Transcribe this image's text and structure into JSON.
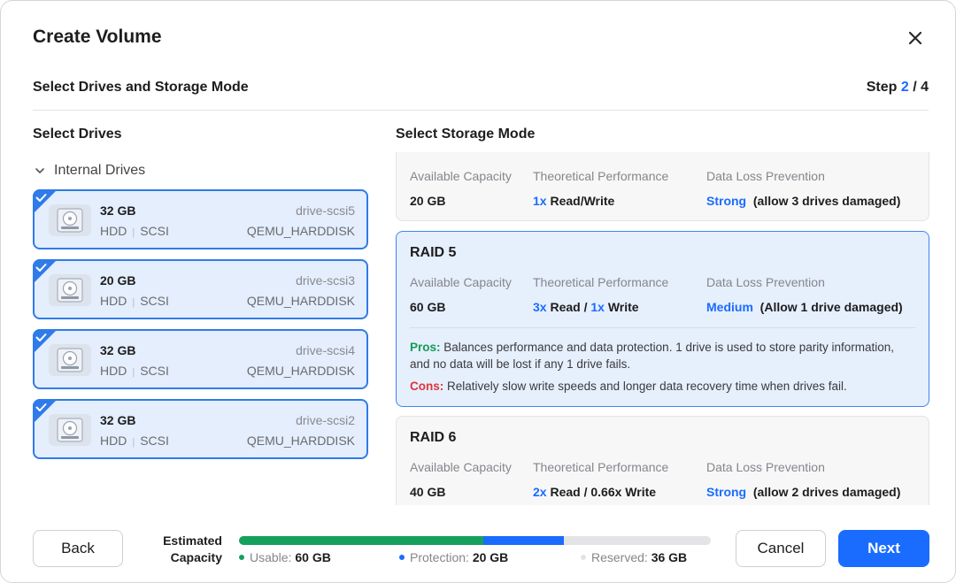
{
  "dialog": {
    "title": "Create Volume",
    "subtitle": "Select Drives and Storage Mode",
    "step_label": "Step",
    "step_current": "2",
    "step_sep": "/",
    "step_total": "4"
  },
  "drives_panel": {
    "title": "Select Drives",
    "group_label": "Internal Drives",
    "drives": [
      {
        "size": "32 GB",
        "type": "HDD",
        "bus": "SCSI",
        "id": "drive-scsi5",
        "model": "QEMU_HARDDISK",
        "selected": true
      },
      {
        "size": "20 GB",
        "type": "HDD",
        "bus": "SCSI",
        "id": "drive-scsi3",
        "model": "QEMU_HARDDISK",
        "selected": true
      },
      {
        "size": "32 GB",
        "type": "HDD",
        "bus": "SCSI",
        "id": "drive-scsi4",
        "model": "QEMU_HARDDISK",
        "selected": true
      },
      {
        "size": "32 GB",
        "type": "HDD",
        "bus": "SCSI",
        "id": "drive-scsi2",
        "model": "QEMU_HARDDISK",
        "selected": true
      }
    ]
  },
  "modes_panel": {
    "title": "Select Storage Mode",
    "headers": {
      "capacity": "Available Capacity",
      "performance": "Theoretical Performance",
      "protection": "Data Loss Prevention"
    },
    "modes": [
      {
        "name": "",
        "capacity": "20 GB",
        "perf_read_mult": "1x",
        "perf_read_text": "Read/Write",
        "protection_level": "Strong",
        "protection_note": "(allow 3 drives damaged)"
      },
      {
        "name": "RAID 5",
        "selected": true,
        "capacity": "60 GB",
        "perf_read_mult": "3x",
        "perf_read_text": "Read /",
        "perf_write_mult": "1x",
        "perf_write_text": "Write",
        "protection_level": "Medium",
        "protection_note": "(Allow 1 drive damaged)",
        "pros_label": "Pros:",
        "pros_text": "Balances performance and data protection. 1 drive is used to store parity information, and no data will be lost if any 1 drive fails.",
        "cons_label": "Cons:",
        "cons_text": "Relatively slow write speeds and longer data recovery time when drives fail."
      },
      {
        "name": "RAID 6",
        "capacity": "40 GB",
        "perf_read_mult": "2x",
        "perf_read_text": "Read / 0.66x Write",
        "protection_level": "Strong",
        "protection_note": "(allow 2 drives damaged)"
      }
    ]
  },
  "footer": {
    "back_label": "Back",
    "estimated_label_1": "Estimated",
    "estimated_label_2": "Capacity",
    "usable_label": "Usable:",
    "usable_value": "60 GB",
    "protection_label": "Protection:",
    "protection_value": "20 GB",
    "reserved_label": "Reserved:",
    "reserved_value": "36 GB",
    "capacity_fractions": {
      "usable": 0.517,
      "protection": 0.172,
      "reserved": 0.311
    },
    "cancel_label": "Cancel",
    "next_label": "Next"
  },
  "colors": {
    "accent": "#1a6cff",
    "usable": "#16a05e",
    "protection": "#1a6cff",
    "reserved": "#e4e4e7",
    "pros": "#129c57",
    "cons": "#e0343a"
  },
  "icons": {
    "close": "close-icon",
    "chevron": "chevron-down-icon",
    "drive": "hard-disk-icon",
    "check": "checkmark-icon"
  }
}
